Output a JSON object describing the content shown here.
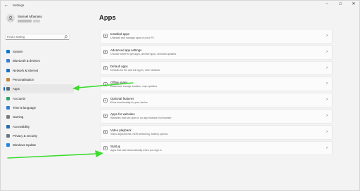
{
  "window": {
    "title": "Settings",
    "back_icon": "back-arrow-icon",
    "controls": [
      "minimize-icon",
      "maximize-icon",
      "close-icon"
    ]
  },
  "profile": {
    "name": "Samuel Mbanaso"
  },
  "search": {
    "placeholder": "Find a setting",
    "icon": "search-icon"
  },
  "sidebar": {
    "items": [
      {
        "label": "System",
        "icon": "system-icon",
        "color": "#0078d4",
        "active": false
      },
      {
        "label": "Bluetooth & devices",
        "icon": "bluetooth-icon",
        "color": "#3a7bd5",
        "active": false
      },
      {
        "label": "Network & internet",
        "icon": "network-icon",
        "color": "#1a6fc9",
        "active": false
      },
      {
        "label": "Personalisation",
        "icon": "personalisation-icon",
        "color": "#c8843a",
        "active": false
      },
      {
        "label": "Apps",
        "icon": "apps-icon",
        "color": "#5a6a7a",
        "active": true
      },
      {
        "label": "Accounts",
        "icon": "accounts-icon",
        "color": "#2fa36b",
        "active": false
      },
      {
        "label": "Time & language",
        "icon": "time-language-icon",
        "color": "#2d7fd3",
        "active": false
      },
      {
        "label": "Gaming",
        "icon": "gaming-icon",
        "color": "#7a7a7a",
        "active": false
      },
      {
        "label": "Accessibility",
        "icon": "accessibility-icon",
        "color": "#2b6cb0",
        "active": false
      },
      {
        "label": "Privacy & security",
        "icon": "privacy-shield-icon",
        "color": "#6b7785",
        "active": false
      },
      {
        "label": "Windows Update",
        "icon": "windows-update-icon",
        "color": "#1e88e5",
        "active": false
      }
    ]
  },
  "main": {
    "title": "Apps",
    "cards": [
      {
        "title": "Installed apps",
        "desc": "Uninstall and manage apps on your PC",
        "icon": "installed-apps-icon"
      },
      {
        "title": "Advanced app settings",
        "desc": "Choose where to get apps, archive apps, uninstall updates",
        "icon": "advanced-apps-icon"
      },
      {
        "title": "Default apps",
        "desc": "Defaults for file and link types, other defaults",
        "icon": "default-apps-icon"
      },
      {
        "title": "Offline maps",
        "desc": "Download, storage location, map updates",
        "icon": "offline-maps-icon"
      },
      {
        "title": "Optional features",
        "desc": "Extra functionality for your device",
        "icon": "optional-features-icon"
      },
      {
        "title": "Apps for websites",
        "desc": "Websites that can open in an app instead of a browser",
        "icon": "apps-for-websites-icon"
      },
      {
        "title": "Video playback",
        "desc": "Video adjustments, HDR streaming, battery options",
        "icon": "video-playback-icon"
      },
      {
        "title": "Startup",
        "desc": "Apps that start automatically when you sign in",
        "icon": "startup-icon"
      }
    ]
  },
  "annotations": {
    "arrow_color": "#3ddc2f"
  }
}
